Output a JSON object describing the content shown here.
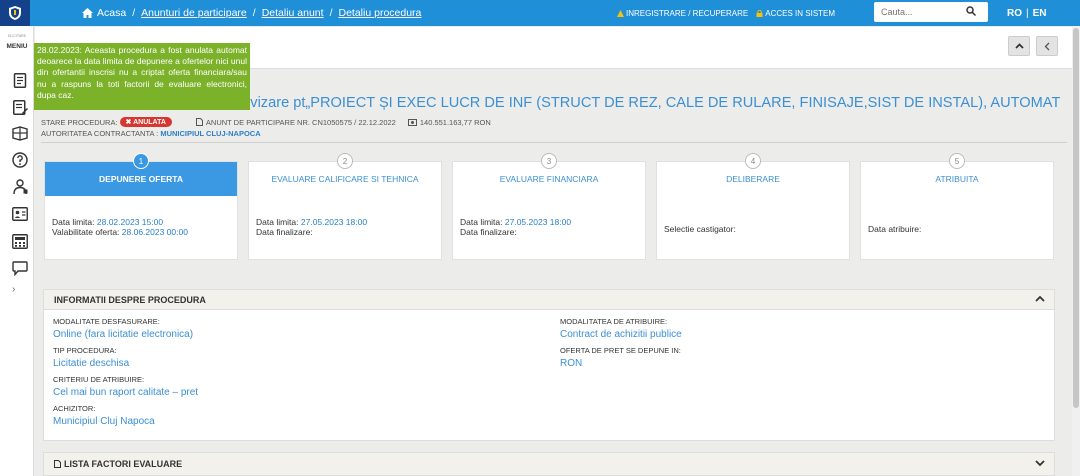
{
  "header": {
    "breadcrumbs": [
      "Acasa",
      "Anunturi de participare",
      "Detaliu anunt",
      "Detaliu procedura"
    ],
    "register_label": "INREGISTRARE / RECUPERARE",
    "login_label": "ACCES IN SISTEM",
    "search_placeholder": "Cauta...",
    "lang_ro": "RO",
    "lang_en": "EN"
  },
  "sidebar": {
    "small_text": "ELICITARE",
    "menu_label": "MENIU"
  },
  "notice": "28.02.2023: Aceasta procedura a fost anulata automat deoarece la data limita de depunere a ofertelor nici unul din ofertantii inscrisi nu a criptat oferta financiara/sau nu a raspuns la toti factorii de evaluare electronici, dupa caz.",
  "procedure": {
    "title": "servizare pt„PROIECT ȘI EXEC LUCR DE INF (STRUCT DE REZ, CALE DE RULARE, FINISAJE,SIST DE INSTAL), AUTOMATIZ TRAFIC, RAC...",
    "status_label": "STARE PROCEDURA:",
    "status_value": "ANULATA",
    "announcement": "ANUNT DE PARTICIPARE NR. CN1050575 / 22.12.2022",
    "value": "140.551.163,77  RON",
    "authority_label": "AUTORITATEA CONTRACTANTA :",
    "authority_value": "MUNICIPIUL CLUJ-NAPOCA"
  },
  "steps": [
    {
      "num": "1",
      "title": "DEPUNERE OFERTA",
      "l1_label": "Data limita: ",
      "l1_value": "28.02.2023 15:00",
      "l2_label": "Valabilitate oferta: ",
      "l2_value": "28.06.2023 00:00"
    },
    {
      "num": "2",
      "title": "EVALUARE CALIFICARE SI TEHNICA",
      "l1_label": "Data limita: ",
      "l1_value": "27.05.2023 18:00",
      "l2_label": "Data finalizare:",
      "l2_value": ""
    },
    {
      "num": "3",
      "title": "EVALUARE FINANCIARA",
      "l1_label": "Data limita: ",
      "l1_value": "27.05.2023 18:00",
      "l2_label": "Data finalizare:",
      "l2_value": ""
    },
    {
      "num": "4",
      "title": "DELIBERARE",
      "single": "Selectie castigator:"
    },
    {
      "num": "5",
      "title": "ATRIBUITA",
      "single": "Data atribuire:"
    }
  ],
  "info": {
    "title": "INFORMATII DESPRE PROCEDURA",
    "modalitate_desfasurare_label": "MODALITATE DESFASURARE:",
    "modalitate_desfasurare_value": "Online (fara licitatie electronica)",
    "tip_procedura_label": "TIP PROCEDURA:",
    "tip_procedura_value": "Licitatie deschisa",
    "criteriu_label": "CRITERIU DE ATRIBUIRE:",
    "criteriu_value": "Cel mai bun raport calitate – pret",
    "achizitor_label": "ACHIZITOR:",
    "achizitor_value": "Municipiul Cluj Napoca",
    "modalitatea_atribuire_label": "MODALITATEA DE ATRIBUIRE:",
    "modalitatea_atribuire_value": "Contract de achizitii publice",
    "oferta_pret_label": "OFERTA DE PRET SE DEPUNE IN:",
    "oferta_pret_value": "RON"
  },
  "factors": {
    "title": "LISTA FACTORI EVALUARE"
  }
}
